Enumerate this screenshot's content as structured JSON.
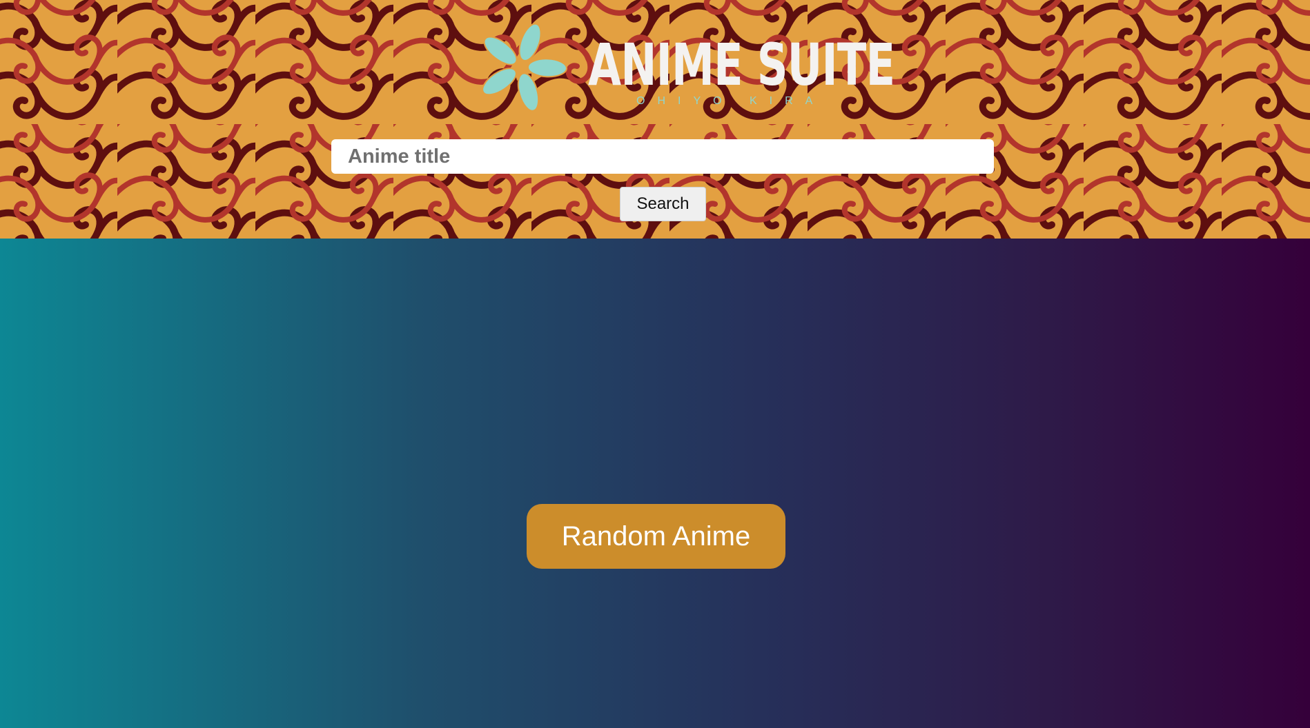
{
  "header": {
    "logo": {
      "title": "ANIME SUITE",
      "subtitle": "OHIYO KIRA"
    },
    "search": {
      "placeholder": "Anime title",
      "value": "",
      "button_label": "Search"
    }
  },
  "main": {
    "random_button_label": "Random Anime"
  },
  "colors": {
    "header_background": "#e3a041",
    "pattern_dark": "#5e0f0f",
    "pattern_red": "#b2352c",
    "logo_accent": "#8fd6cd",
    "gradient_start": "#0d8794",
    "gradient_end": "#35003a",
    "random_button": "#cc8d2b"
  },
  "icons": {
    "logo_mark": "flower-icon"
  }
}
